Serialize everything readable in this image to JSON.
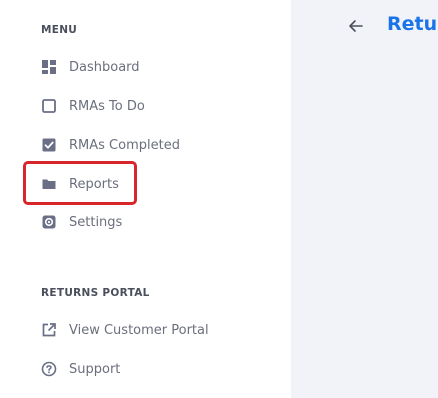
{
  "sidebar": {
    "menu_title": "MENU",
    "menu_items": [
      {
        "label": "Dashboard",
        "icon": "dashboard-icon"
      },
      {
        "label": "RMAs To Do",
        "icon": "checkbox-empty-icon"
      },
      {
        "label": "RMAs Completed",
        "icon": "checkbox-checked-icon"
      },
      {
        "label": "Reports",
        "icon": "folder-icon"
      },
      {
        "label": "Settings",
        "icon": "gear-icon"
      }
    ],
    "portal_title": "RETURNS PORTAL",
    "portal_items": [
      {
        "label": "View Customer Portal",
        "icon": "external-link-icon"
      },
      {
        "label": "Support",
        "icon": "help-circle-icon"
      }
    ]
  },
  "main": {
    "title": "Retu",
    "back_icon": "back-arrow-icon"
  },
  "colors": {
    "highlight": "#d7262b",
    "icon": "#6b6f86",
    "accent": "#1a73e8",
    "main_bg": "#f1f3f9"
  }
}
